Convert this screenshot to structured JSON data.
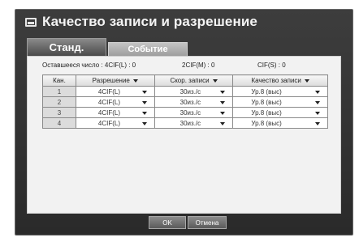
{
  "dialog": {
    "title": "Качество записи и разрешение",
    "tabs": [
      {
        "label": "Станд.",
        "active": true
      },
      {
        "label": "Событие",
        "active": false
      }
    ],
    "remaining": {
      "label": "Оставшееся число : 4CIF(L) : 0",
      "cif2": "2CIF(M) : 0",
      "cif": "CIF(S) : 0"
    },
    "table": {
      "headers": [
        "Кан.",
        "Разрешение",
        "Скор. записи",
        "Качество записи"
      ],
      "rows": [
        {
          "ch": "1",
          "resolution": "4CIF(L)",
          "rate": "30из./с",
          "quality": "Ур.8 (выс)"
        },
        {
          "ch": "2",
          "resolution": "4CIF(L)",
          "rate": "30из./с",
          "quality": "Ур.8 (выс)"
        },
        {
          "ch": "3",
          "resolution": "4CIF(L)",
          "rate": "30из./с",
          "quality": "Ур.8 (выс)"
        },
        {
          "ch": "4",
          "resolution": "4CIF(L)",
          "rate": "30из./с",
          "quality": "Ур.8 (выс)"
        }
      ]
    },
    "buttons": {
      "ok": "OK",
      "cancel": "Отмена"
    }
  }
}
